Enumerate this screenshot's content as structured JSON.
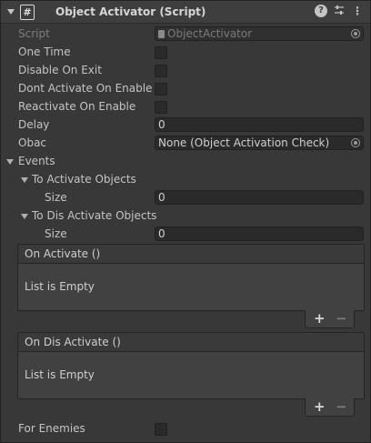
{
  "component": {
    "title": "Object Activator (Script)",
    "script_icon_glyph": "#",
    "icons": [
      "foldout-arrow-icon",
      "script-icon",
      "help-icon",
      "preset-icon",
      "context-menu-icon"
    ]
  },
  "fields": {
    "script_label": "Script",
    "script_value": "ObjectActivator",
    "one_time_label": "One Time",
    "disable_on_exit_label": "Disable On Exit",
    "dont_activate_on_enable_label": "Dont Activate On Enable",
    "reactivate_on_enable_label": "Reactivate On Enable",
    "delay_label": "Delay",
    "delay_value": "0",
    "obac_label": "Obac",
    "obac_value": "None (Object Activation Check)",
    "events_label": "Events",
    "to_activate_label": "To Activate Objects",
    "to_activate_size_label": "Size",
    "to_activate_size_value": "0",
    "to_dis_activate_label": "To Dis Activate Objects",
    "to_dis_activate_size_label": "Size",
    "to_dis_activate_size_value": "0",
    "for_enemies_label": "For Enemies"
  },
  "checkboxes": {
    "one_time": false,
    "disable_on_exit": false,
    "dont_activate_on_enable": false,
    "reactivate_on_enable": false,
    "for_enemies": false
  },
  "events": {
    "on_activate_title": "On Activate ()",
    "on_activate_empty": "List is Empty",
    "on_dis_activate_title": "On Dis Activate ()",
    "on_dis_activate_empty": "List is Empty",
    "add_glyph": "+",
    "remove_glyph": "−"
  },
  "colors": {
    "background": "#383838",
    "header": "#3e3e3e",
    "field": "#2a2a2a",
    "text": "#c4c4c4",
    "disabled_text": "#7d7d7d"
  }
}
